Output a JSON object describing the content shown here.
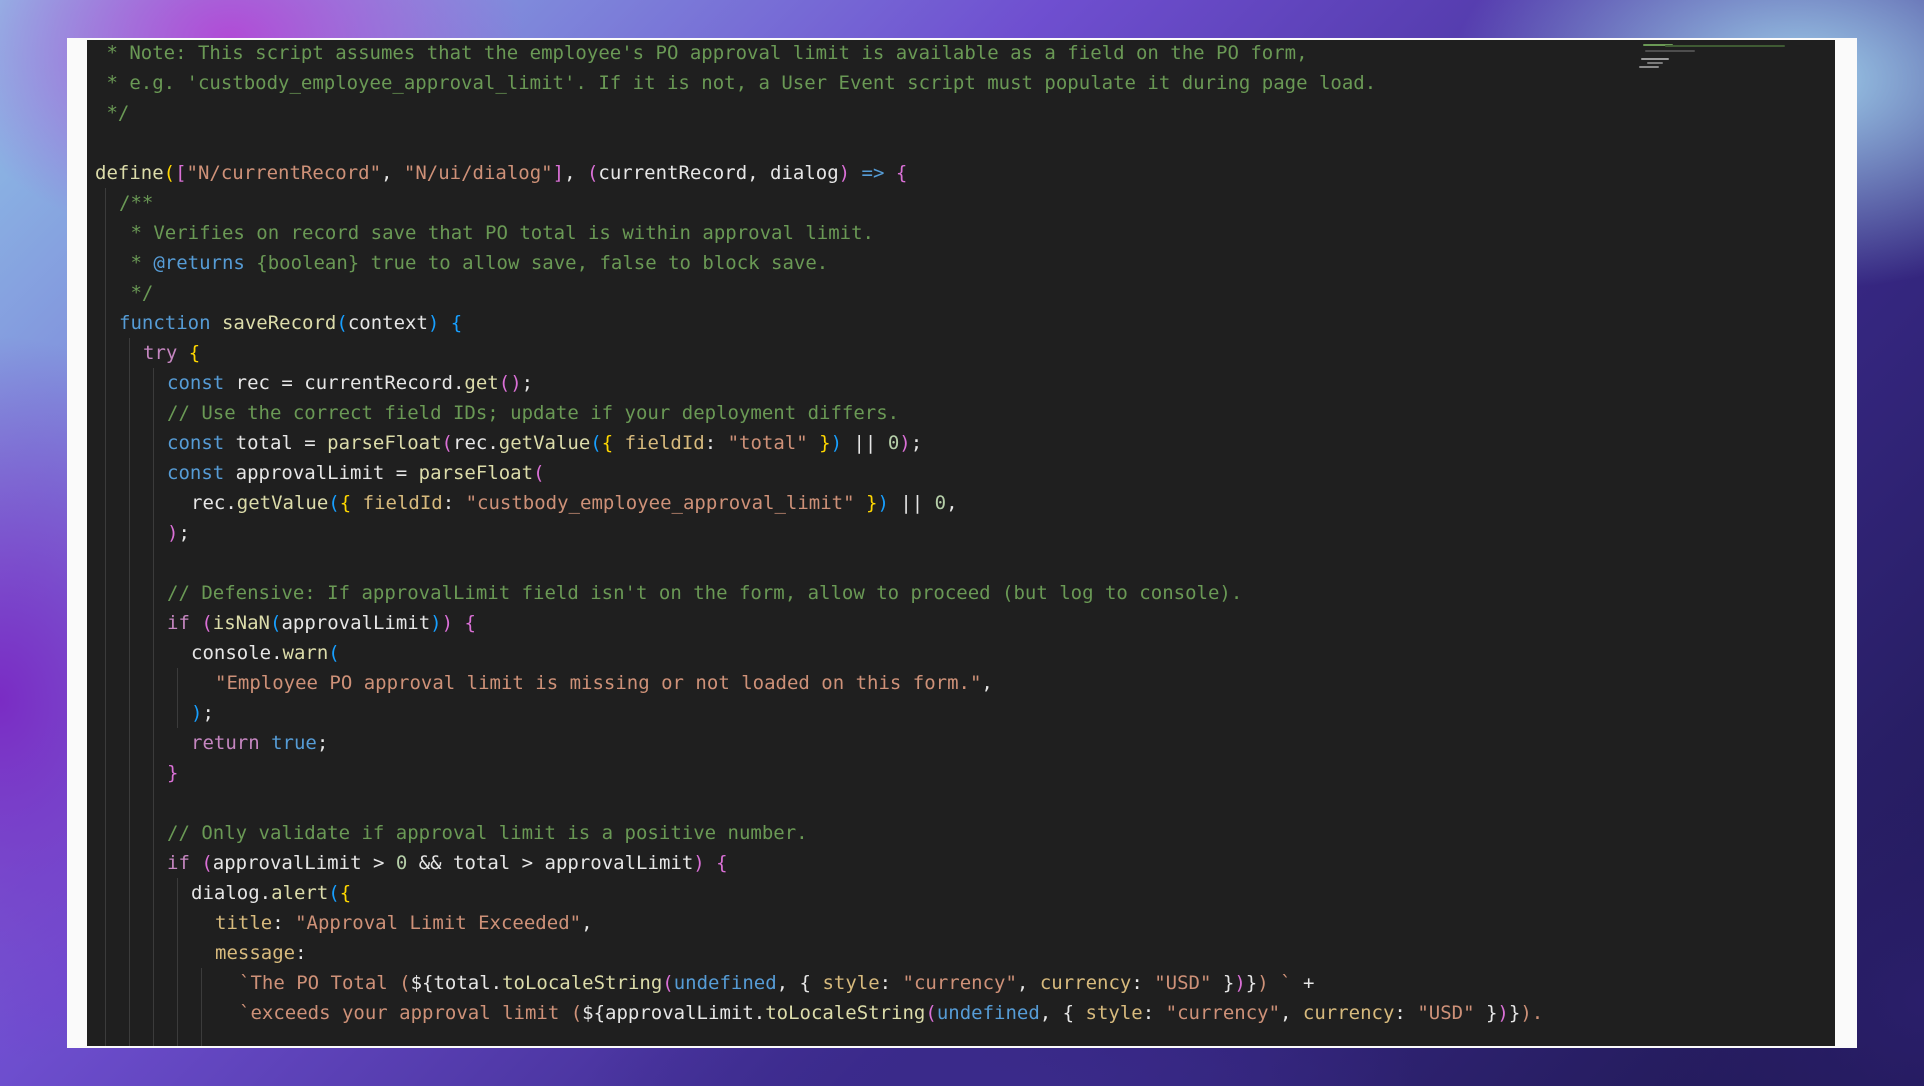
{
  "editor": {
    "language": "javascript",
    "lines": [
      {
        "indent": 0,
        "tokens": [
          [
            "cm",
            " * Note: This script assumes that the employee's PO approval limit is available as a field on the PO form,"
          ]
        ]
      },
      {
        "indent": 0,
        "tokens": [
          [
            "cm",
            " * e.g. 'custbody_employee_approval_limit'. If it is not, a User Event script must populate it during page load."
          ]
        ]
      },
      {
        "indent": 0,
        "tokens": [
          [
            "cm",
            " */"
          ]
        ]
      },
      {
        "indent": 0,
        "tokens": []
      },
      {
        "indent": 0,
        "tokens": [
          [
            "fn",
            "define"
          ],
          [
            "br1",
            "("
          ],
          [
            "br2",
            "["
          ],
          [
            "str",
            "\"N/currentRecord\""
          ],
          [
            "var",
            ", "
          ],
          [
            "str",
            "\"N/ui/dialog\""
          ],
          [
            "br2",
            "]"
          ],
          [
            "var",
            ", "
          ],
          [
            "br2",
            "("
          ],
          [
            "var",
            "currentRecord, dialog"
          ],
          [
            "br2",
            ")"
          ],
          [
            "var",
            " "
          ],
          [
            "kw",
            "=>"
          ],
          [
            "var",
            " "
          ],
          [
            "br2",
            "{"
          ]
        ]
      },
      {
        "indent": 1,
        "tokens": [
          [
            "cm",
            "/**"
          ]
        ]
      },
      {
        "indent": 1,
        "tokens": [
          [
            "cm",
            " * Verifies on record save that PO total is within approval limit."
          ]
        ]
      },
      {
        "indent": 1,
        "tokens": [
          [
            "cm",
            " * "
          ],
          [
            "tag",
            "@returns"
          ],
          [
            "cm",
            " {boolean} true to allow save, false to block save."
          ]
        ]
      },
      {
        "indent": 1,
        "tokens": [
          [
            "cm",
            " */"
          ]
        ]
      },
      {
        "indent": 1,
        "tokens": [
          [
            "kw",
            "function"
          ],
          [
            "var",
            " "
          ],
          [
            "fn",
            "saveRecord"
          ],
          [
            "br3",
            "("
          ],
          [
            "var",
            "context"
          ],
          [
            "br3",
            ")"
          ],
          [
            "var",
            " "
          ],
          [
            "br3",
            "{"
          ]
        ]
      },
      {
        "indent": 2,
        "tokens": [
          [
            "pur",
            "try"
          ],
          [
            "var",
            " "
          ],
          [
            "br1",
            "{"
          ]
        ]
      },
      {
        "indent": 3,
        "tokens": [
          [
            "kw",
            "const"
          ],
          [
            "var",
            " rec = currentRecord."
          ],
          [
            "fn",
            "get"
          ],
          [
            "br2",
            "()"
          ],
          [
            "var",
            ";"
          ]
        ]
      },
      {
        "indent": 3,
        "tokens": [
          [
            "cm",
            "// Use the correct field IDs; update if your deployment differs."
          ]
        ]
      },
      {
        "indent": 3,
        "tokens": [
          [
            "kw",
            "const"
          ],
          [
            "var",
            " total = "
          ],
          [
            "fn",
            "parseFloat"
          ],
          [
            "br2",
            "("
          ],
          [
            "var",
            "rec."
          ],
          [
            "fn",
            "getValue"
          ],
          [
            "br3",
            "("
          ],
          [
            "br1",
            "{"
          ],
          [
            "var",
            " "
          ],
          [
            "prop",
            "fieldId"
          ],
          [
            "var",
            ": "
          ],
          [
            "str",
            "\"total\""
          ],
          [
            "var",
            " "
          ],
          [
            "br1",
            "}"
          ],
          [
            "br3",
            ")"
          ],
          [
            "var",
            " || "
          ],
          [
            "num",
            "0"
          ],
          [
            "br2",
            ")"
          ],
          [
            "var",
            ";"
          ]
        ]
      },
      {
        "indent": 3,
        "tokens": [
          [
            "kw",
            "const"
          ],
          [
            "var",
            " approvalLimit = "
          ],
          [
            "fn",
            "parseFloat"
          ],
          [
            "br2",
            "("
          ]
        ]
      },
      {
        "indent": 4,
        "tokens": [
          [
            "var",
            "rec."
          ],
          [
            "fn",
            "getValue"
          ],
          [
            "br3",
            "("
          ],
          [
            "br1",
            "{"
          ],
          [
            "var",
            " "
          ],
          [
            "prop",
            "fieldId"
          ],
          [
            "var",
            ": "
          ],
          [
            "str",
            "\"custbody_employee_approval_limit\""
          ],
          [
            "var",
            " "
          ],
          [
            "br1",
            "}"
          ],
          [
            "br3",
            ")"
          ],
          [
            "var",
            " || "
          ],
          [
            "num",
            "0"
          ],
          [
            "var",
            ","
          ]
        ]
      },
      {
        "indent": 3,
        "tokens": [
          [
            "br2",
            ")"
          ],
          [
            "var",
            ";"
          ]
        ]
      },
      {
        "indent": 0,
        "tokens": []
      },
      {
        "indent": 3,
        "tokens": [
          [
            "cm",
            "// Defensive: If approvalLimit field isn't on the form, allow to proceed (but log to console)."
          ]
        ]
      },
      {
        "indent": 3,
        "tokens": [
          [
            "pur",
            "if"
          ],
          [
            "var",
            " "
          ],
          [
            "br2",
            "("
          ],
          [
            "fn",
            "isNaN"
          ],
          [
            "br3",
            "("
          ],
          [
            "var",
            "approvalLimit"
          ],
          [
            "br3",
            ")"
          ],
          [
            "br2",
            ")"
          ],
          [
            "var",
            " "
          ],
          [
            "br2",
            "{"
          ]
        ]
      },
      {
        "indent": 4,
        "tokens": [
          [
            "var",
            "console."
          ],
          [
            "fn",
            "warn"
          ],
          [
            "br3",
            "("
          ]
        ]
      },
      {
        "indent": 5,
        "tokens": [
          [
            "str",
            "\"Employee PO approval limit is missing or not loaded on this form.\""
          ],
          [
            "var",
            ","
          ]
        ]
      },
      {
        "indent": 4,
        "tokens": [
          [
            "br3",
            ")"
          ],
          [
            "var",
            ";"
          ]
        ]
      },
      {
        "indent": 4,
        "tokens": [
          [
            "pur",
            "return"
          ],
          [
            "var",
            " "
          ],
          [
            "kw",
            "true"
          ],
          [
            "var",
            ";"
          ]
        ]
      },
      {
        "indent": 3,
        "tokens": [
          [
            "br2",
            "}"
          ]
        ]
      },
      {
        "indent": 0,
        "tokens": []
      },
      {
        "indent": 3,
        "tokens": [
          [
            "cm",
            "// Only validate if approval limit is a positive number."
          ]
        ]
      },
      {
        "indent": 3,
        "tokens": [
          [
            "pur",
            "if"
          ],
          [
            "var",
            " "
          ],
          [
            "br2",
            "("
          ],
          [
            "var",
            "approvalLimit > "
          ],
          [
            "num",
            "0"
          ],
          [
            "var",
            " && total > approvalLimit"
          ],
          [
            "br2",
            ")"
          ],
          [
            "var",
            " "
          ],
          [
            "br2",
            "{"
          ]
        ]
      },
      {
        "indent": 4,
        "tokens": [
          [
            "var",
            "dialog."
          ],
          [
            "fn",
            "alert"
          ],
          [
            "br3",
            "("
          ],
          [
            "br1",
            "{"
          ]
        ]
      },
      {
        "indent": 5,
        "tokens": [
          [
            "prop",
            "title"
          ],
          [
            "var",
            ": "
          ],
          [
            "str",
            "\"Approval Limit Exceeded\""
          ],
          [
            "var",
            ","
          ]
        ]
      },
      {
        "indent": 5,
        "tokens": [
          [
            "prop",
            "message"
          ],
          [
            "var",
            ":"
          ]
        ]
      },
      {
        "indent": 6,
        "tokens": [
          [
            "str",
            "`The PO Total ("
          ],
          [
            "var",
            "${total."
          ],
          [
            "fn",
            "toLocaleString"
          ],
          [
            "br2",
            "("
          ],
          [
            "kw",
            "undefined"
          ],
          [
            "var",
            ", { "
          ],
          [
            "prop",
            "style"
          ],
          [
            "var",
            ": "
          ],
          [
            "str",
            "\"currency\""
          ],
          [
            "var",
            ", "
          ],
          [
            "prop",
            "currency"
          ],
          [
            "var",
            ": "
          ],
          [
            "str",
            "\"USD\""
          ],
          [
            "var",
            " }"
          ],
          [
            "br2",
            ")"
          ],
          [
            "var",
            "}"
          ],
          [
            "str",
            ") `"
          ],
          [
            "var",
            " +"
          ]
        ]
      },
      {
        "indent": 6,
        "tokens": [
          [
            "str",
            "`exceeds your approval limit ("
          ],
          [
            "var",
            "${approvalLimit."
          ],
          [
            "fn",
            "toLocaleString"
          ],
          [
            "br2",
            "("
          ],
          [
            "kw",
            "undefined"
          ],
          [
            "var",
            ", { "
          ],
          [
            "prop",
            "style"
          ],
          [
            "var",
            ": "
          ],
          [
            "str",
            "\"currency\""
          ],
          [
            "var",
            ", "
          ],
          [
            "prop",
            "currency"
          ],
          [
            "var",
            ": "
          ],
          [
            "str",
            "\"USD\""
          ],
          [
            "var",
            " }"
          ],
          [
            "br2",
            ")"
          ],
          [
            "var",
            "}"
          ],
          [
            "str",
            ")."
          ]
        ]
      }
    ],
    "colors": {
      "background": "#1f1f1f",
      "frame": "#fafafa",
      "comment": "#6a9955",
      "keyword": "#569cd6",
      "string": "#ce9178"
    }
  }
}
